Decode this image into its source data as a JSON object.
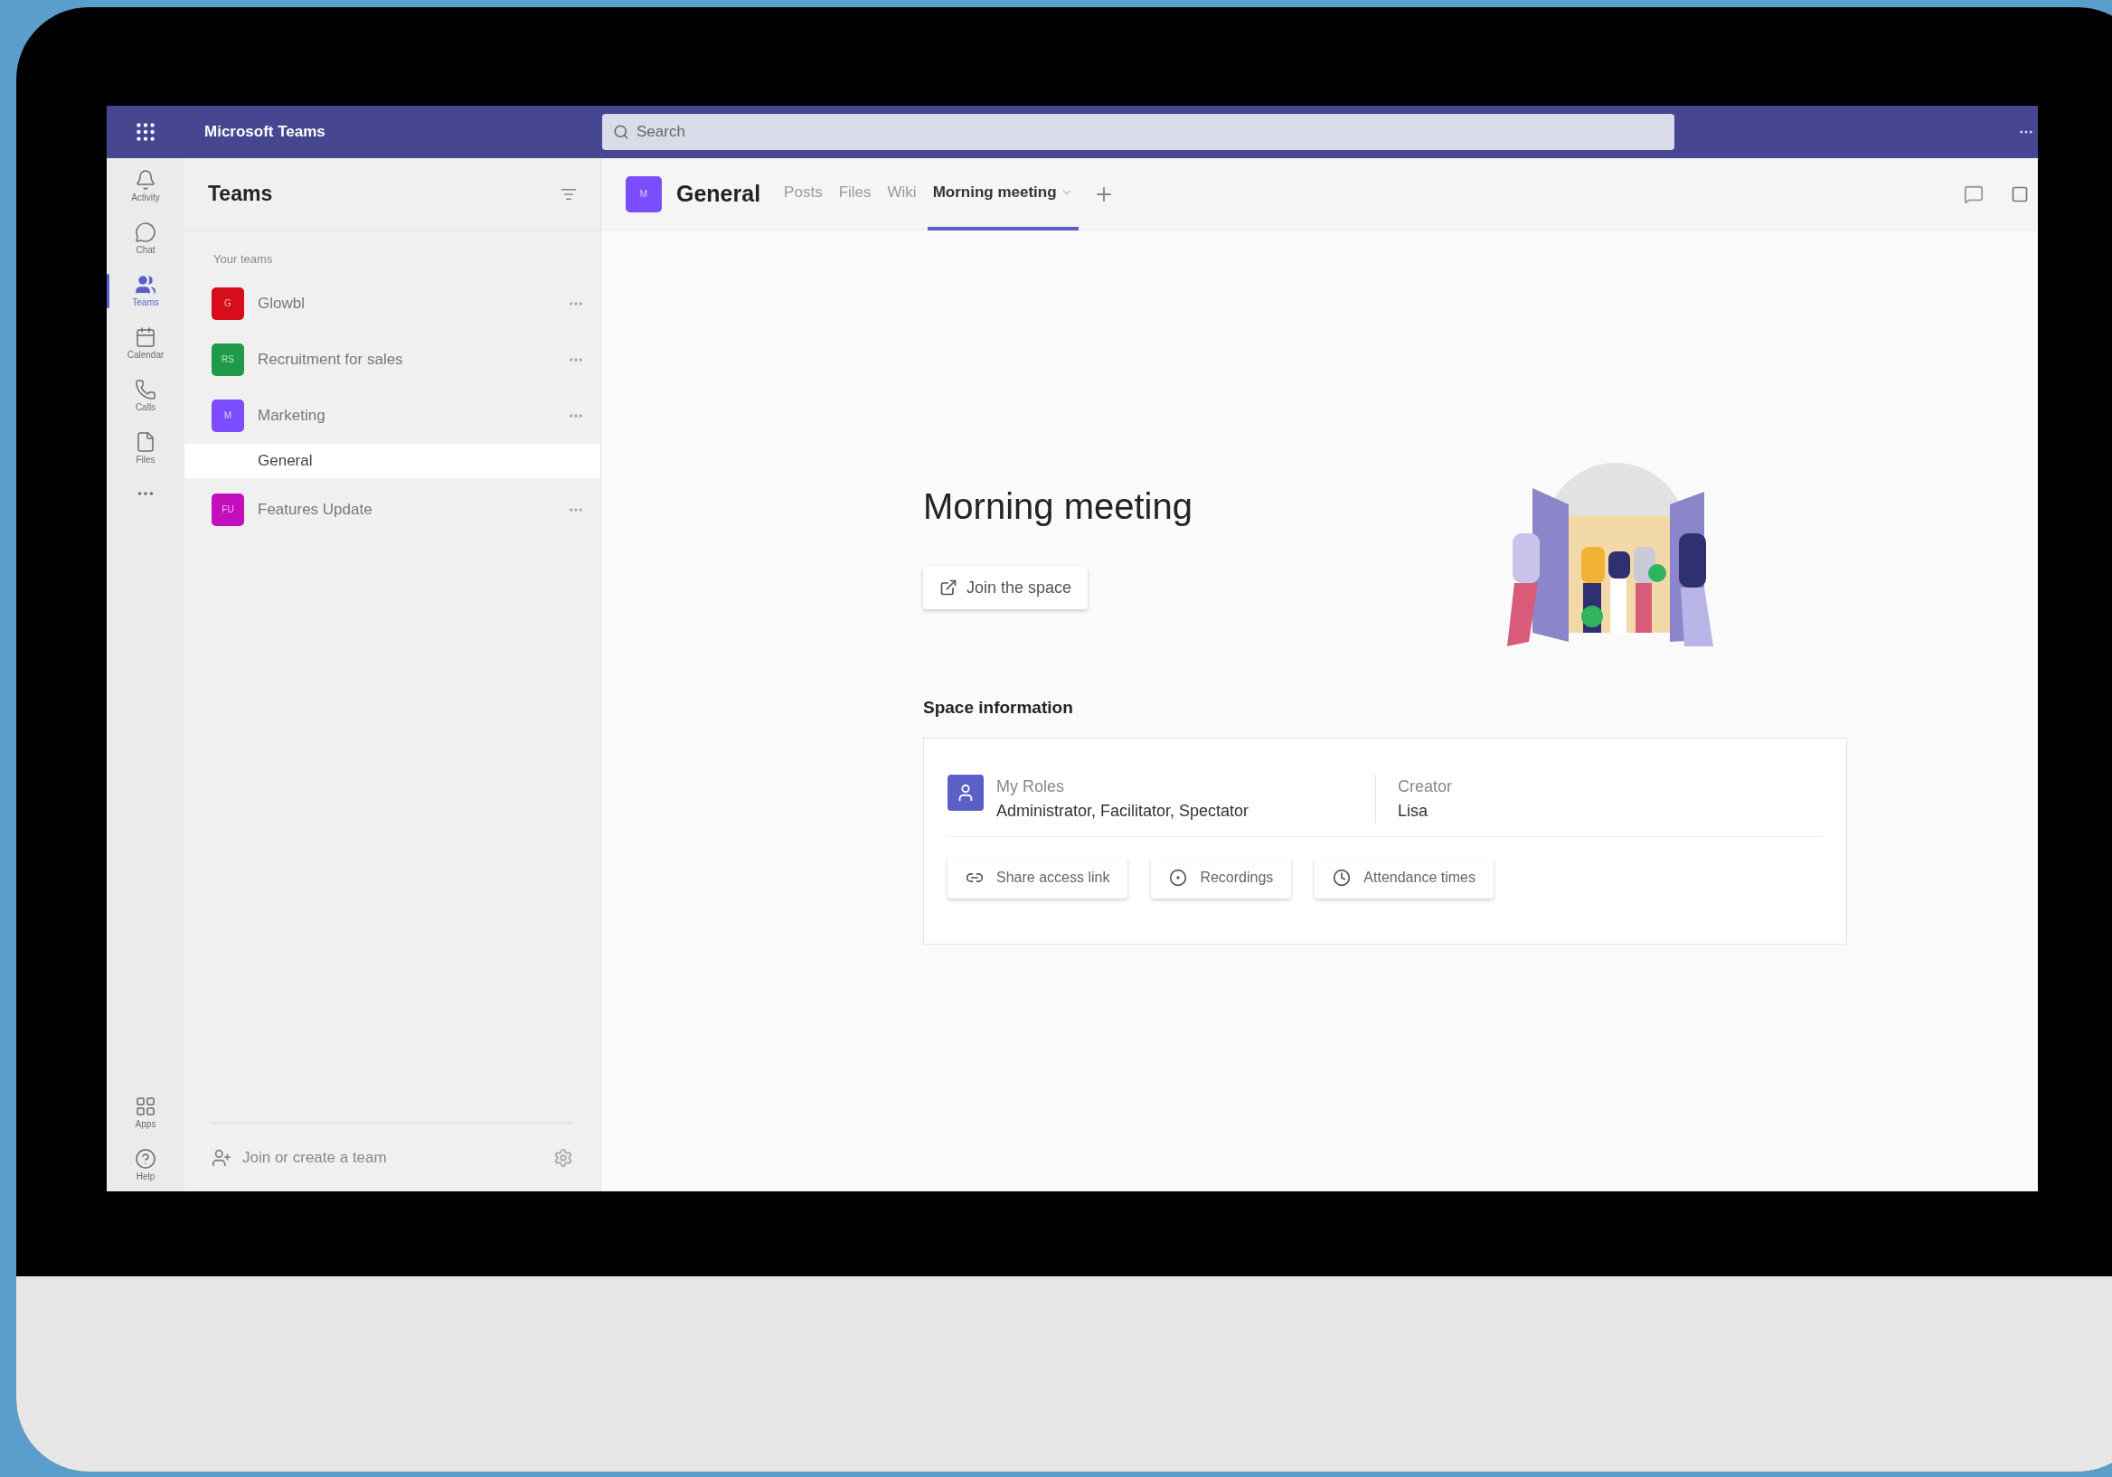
{
  "app_bar": {
    "title": "Microsoft Teams",
    "search": {
      "placeholder": "Search"
    }
  },
  "rail": {
    "top": [
      {
        "label": "Activity",
        "selected": false
      },
      {
        "label": "Chat",
        "selected": false
      },
      {
        "label": "Teams",
        "selected": true
      },
      {
        "label": "Calendar",
        "selected": false
      },
      {
        "label": "Calls",
        "selected": false
      },
      {
        "label": "Files",
        "selected": false
      }
    ],
    "bottom": [
      {
        "label": "Apps",
        "selected": false
      },
      {
        "label": "Help",
        "selected": false
      }
    ]
  },
  "teams_panel": {
    "title": "Teams",
    "section": "Your teams",
    "teams": [
      {
        "name": "Glowbl",
        "initials": "G",
        "color": "#d70c1c"
      },
      {
        "name": "Recruitment for sales",
        "initials": "RS",
        "color": "#1f9a4a"
      },
      {
        "name": "Marketing",
        "initials": "M",
        "color": "#7c4dff",
        "children": [
          {
            "name": "General",
            "selected": true
          }
        ]
      },
      {
        "name": "Features Update",
        "initials": "FU",
        "color": "#c40fbf"
      }
    ],
    "footer": "Join or create a team"
  },
  "channel_header": {
    "avatar": "M",
    "name": "General",
    "tabs": [
      {
        "label": "Posts",
        "selected": false,
        "has_menu": false
      },
      {
        "label": "Files",
        "selected": false,
        "has_menu": false
      },
      {
        "label": "Wiki",
        "selected": false,
        "has_menu": false
      },
      {
        "label": "Morning meeting",
        "selected": true,
        "has_menu": true
      }
    ]
  },
  "space": {
    "title": "Morning meeting",
    "join_button": "Join the space",
    "info_title": "Space information",
    "roles_label": "My Roles",
    "roles_value": "Administrator, Facilitator, Spectator",
    "creator_label": "Creator",
    "creator_value": "Lisa",
    "actions": [
      {
        "label": "Share access link"
      },
      {
        "label": "Recordings"
      },
      {
        "label": "Attendance times"
      }
    ]
  }
}
